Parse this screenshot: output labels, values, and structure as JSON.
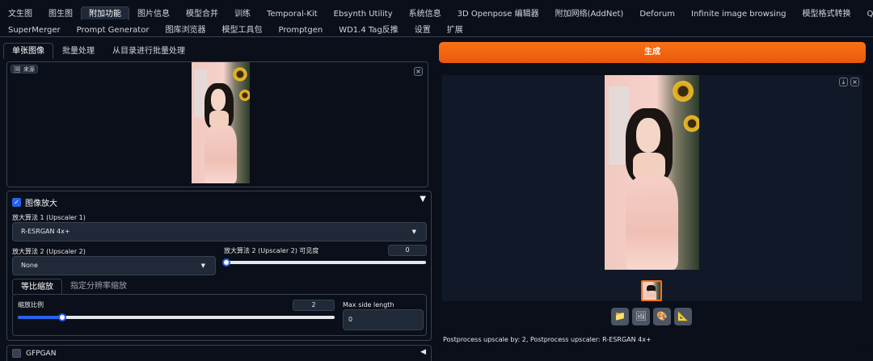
{
  "top_tabs_row1": [
    "文生图",
    "图生图",
    "附加功能",
    "图片信息",
    "模型合并",
    "训练",
    "Temporal-Kit",
    "Ebsynth Utility",
    "系统信息",
    "3D Openpose 编辑器",
    "附加网络(AddNet)",
    "Deforum",
    "Infinite image browsing",
    "模型格式转换",
    "QR Toolkit"
  ],
  "top_tabs_row2": [
    "SuperMerger",
    "Prompt Generator",
    "图库浏览器",
    "模型工具包",
    "Promptgen",
    "WD1.4 Tag反推",
    "设置",
    "扩展"
  ],
  "active_top_tab": "附加功能",
  "sub_tabs": [
    "单张图像",
    "批量处理",
    "从目录进行批量处理"
  ],
  "source": {
    "label": "来源",
    "close": "×"
  },
  "upscale": {
    "section_title": "图像放大",
    "collapse_arrow": "▼",
    "upscaler1_label": "放大算法 1 (Upscaler 1)",
    "upscaler1_value": "R-ESRGAN 4x+",
    "upscaler2_label": "放大算法 2 (Upscaler 2)",
    "upscaler2_value": "None",
    "visibility_label": "放大算法 2 (Upscaler 2) 可见度",
    "visibility_value": "0",
    "resize_tabs": [
      "等比缩放",
      "指定分辨率缩放"
    ],
    "scale_label": "缩放比例",
    "scale_value": "2",
    "scale_fraction": 0.14,
    "max_side_label": "Max side length",
    "max_side_value": "0"
  },
  "gfpgan": {
    "label": "GFPGAN",
    "arrow": "◀"
  },
  "generate_button": "生成",
  "output": {
    "info_text": "Postprocess upscale by: 2, Postprocess upscaler: R-ESRGAN 4x+",
    "download_icon": "⤓",
    "close_icon": "×"
  },
  "icon_buttons": [
    "folder-icon",
    "image-icon",
    "palette-icon",
    "ruler-icon"
  ],
  "colors": {
    "generate": "#f97316",
    "accent": "#2563eb",
    "background": "#0b0f19"
  }
}
